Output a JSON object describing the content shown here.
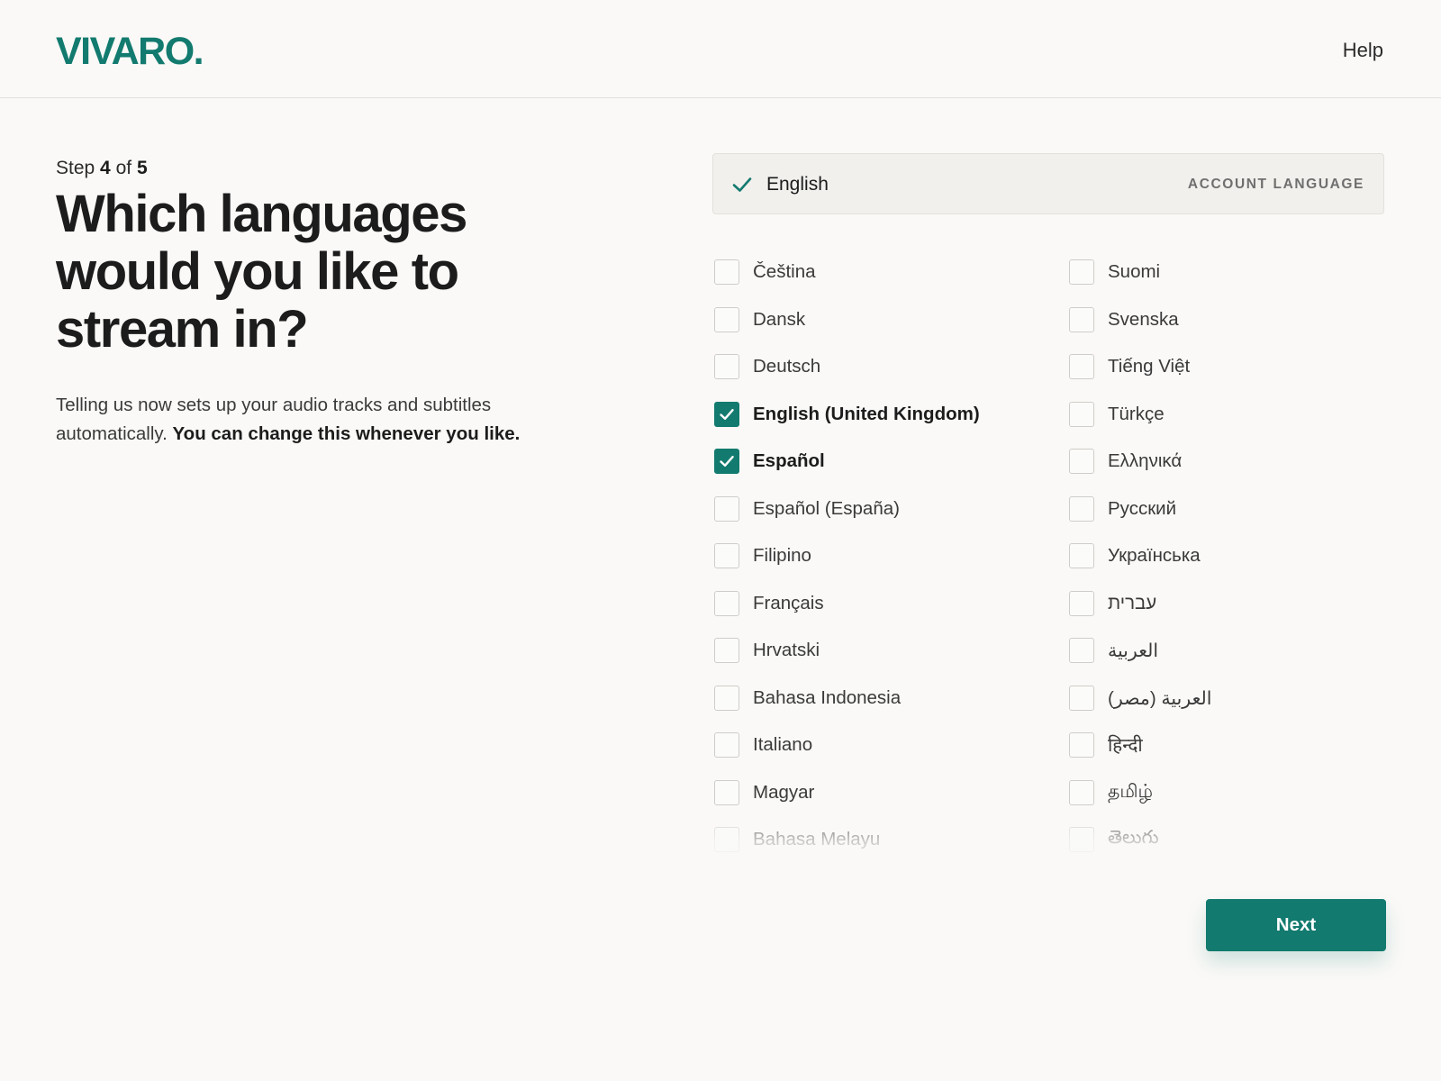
{
  "brand": {
    "logo": "VIVARO."
  },
  "nav": {
    "help": "Help"
  },
  "step": {
    "prefix": "Step",
    "current": "4",
    "of": "of",
    "total": "5"
  },
  "heading": "Which languages would you like to stream in?",
  "description": {
    "normal": "Telling us now sets up your audio tracks and subtitles automatically.",
    "bold": "You can change this whenever you like."
  },
  "account_language": {
    "name": "English",
    "tag": "ACCOUNT LANGUAGE"
  },
  "languages_left": [
    {
      "label": "Čeština",
      "checked": false
    },
    {
      "label": "Dansk",
      "checked": false
    },
    {
      "label": "Deutsch",
      "checked": false
    },
    {
      "label": "English (United Kingdom)",
      "checked": true
    },
    {
      "label": "Español",
      "checked": true
    },
    {
      "label": "Español (España)",
      "checked": false
    },
    {
      "label": "Filipino",
      "checked": false
    },
    {
      "label": "Français",
      "checked": false
    },
    {
      "label": "Hrvatski",
      "checked": false
    },
    {
      "label": "Bahasa Indonesia",
      "checked": false
    },
    {
      "label": "Italiano",
      "checked": false
    },
    {
      "label": "Magyar",
      "checked": false
    },
    {
      "label": "Bahasa Melayu",
      "checked": false
    }
  ],
  "languages_right": [
    {
      "label": "Suomi",
      "checked": false
    },
    {
      "label": "Svenska",
      "checked": false
    },
    {
      "label": "Tiếng Việt",
      "checked": false
    },
    {
      "label": "Türkçe",
      "checked": false
    },
    {
      "label": "Ελληνικά",
      "checked": false
    },
    {
      "label": "Русский",
      "checked": false
    },
    {
      "label": "Українська",
      "checked": false
    },
    {
      "label": "עברית",
      "checked": false
    },
    {
      "label": "العربية",
      "checked": false
    },
    {
      "label": "العربية (مصر)",
      "checked": false
    },
    {
      "label": "हिन्दी",
      "checked": false
    },
    {
      "label": "தமிழ்",
      "checked": false
    },
    {
      "label": "తెలుగు",
      "checked": false
    }
  ],
  "buttons": {
    "next": "Next"
  },
  "colors": {
    "accent": "#137a6f",
    "background": "#faf9f7",
    "text": "#1c1c1c"
  }
}
